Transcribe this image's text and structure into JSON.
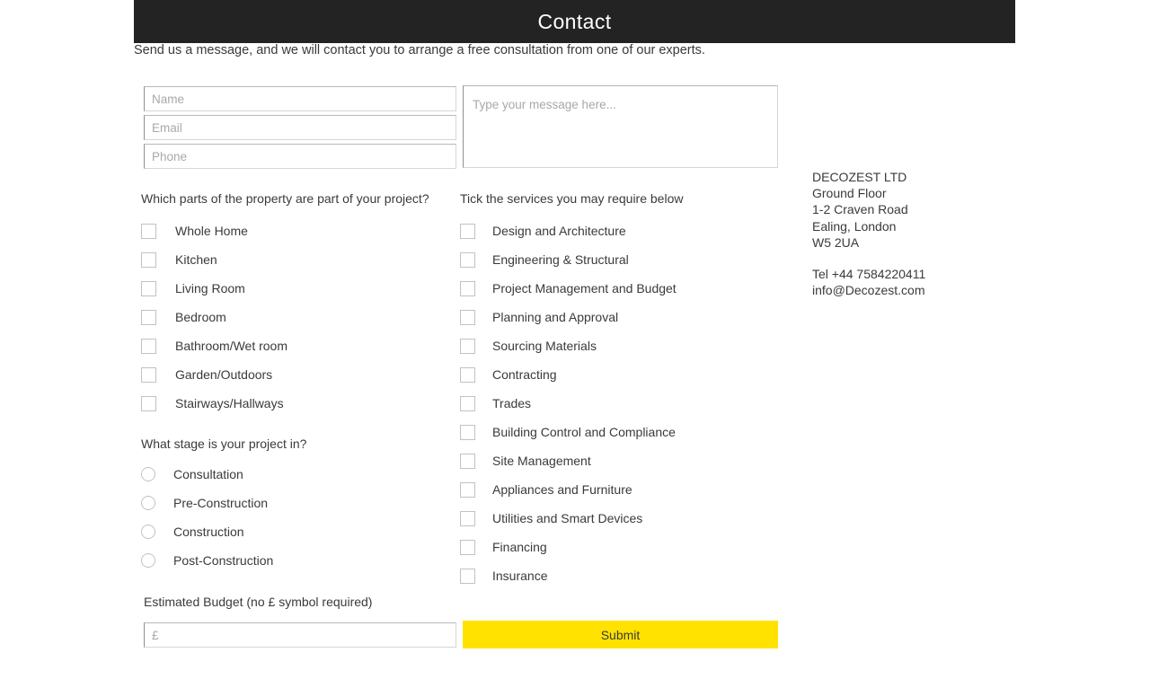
{
  "header": {
    "title": "Contact",
    "bar_color": "#232323"
  },
  "intro": {
    "text": "Send us a message, and we will contact you to arrange a free consultation from one of our experts."
  },
  "form": {
    "name_placeholder": "Name",
    "email_placeholder": "Email",
    "phone_placeholder": "Phone",
    "message_placeholder": "Type your message here...",
    "property_heading": "Which parts of the property are part of your project?",
    "property_options": [
      "Whole Home",
      "Kitchen",
      "Living Room",
      "Bedroom",
      "Bathroom/Wet room",
      "Garden/Outdoors",
      "Stairways/Hallways"
    ],
    "stage_heading": "What stage is your project in?",
    "stage_options": [
      "Consultation",
      "Pre-Construction",
      "Construction",
      "Post-Construction"
    ],
    "services_heading": "Tick the services you may require below",
    "services_options": [
      "Design and Architecture",
      "Engineering & Structural",
      "Project Management and Budget",
      "Planning and Approval",
      "Sourcing Materials",
      "Contracting",
      "Trades",
      "Building Control and Compliance",
      "Site Management",
      "Appliances and Furniture",
      "Utilities and Smart Devices",
      "Financing",
      "Insurance"
    ],
    "budget_label": "Estimated Budget (no £ symbol required)",
    "budget_placeholder": "£",
    "submit_label": "Submit",
    "submit_color": "#FFE200"
  },
  "company": {
    "name": "DECOZEST LTD",
    "address_line1": "Ground Floor",
    "address_line2": "1-2 Craven Road",
    "address_line3": "Ealing, London",
    "address_line4": "W5 2UA",
    "phone": "Tel +44 7584220411",
    "email": "info@Decozest.com"
  }
}
